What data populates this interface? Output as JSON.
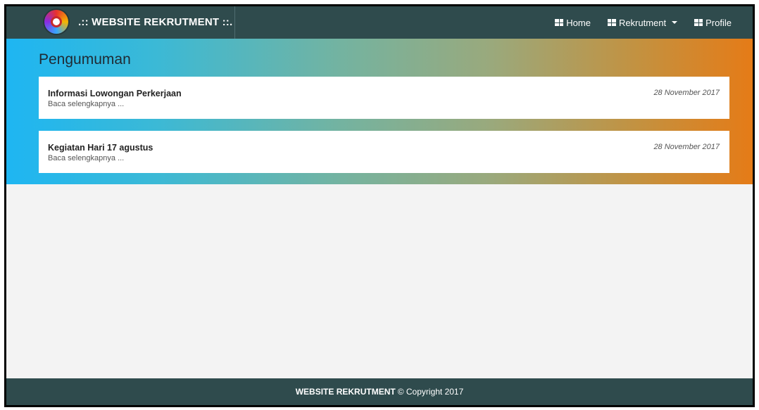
{
  "navbar": {
    "brand": ".:: WEBSITE REKRUTMENT ::.",
    "items": [
      {
        "label": "Home",
        "icon": "grid-icon"
      },
      {
        "label": "Rekrutment",
        "icon": "grid-icon",
        "has_dropdown": true
      },
      {
        "label": "Profile",
        "icon": "grid-icon"
      }
    ]
  },
  "main": {
    "title": "Pengumuman",
    "announcements": [
      {
        "title": "Informasi Lowongan Perkerjaan",
        "link": "Baca selengkapnya ...",
        "date": "28 November 2017"
      },
      {
        "title": "Kegiatan Hari 17 agustus",
        "link": "Baca selengkapnya ...",
        "date": "28 November 2017"
      }
    ]
  },
  "footer": {
    "brand": "WEBSITE REKRUTMENT",
    "copyright": "© Copyright 2017"
  },
  "colors": {
    "navbar": "#2f4b4d",
    "gradient_start": "#1eb6f2",
    "gradient_end": "#e57b17",
    "background": "#f3f3f3"
  }
}
